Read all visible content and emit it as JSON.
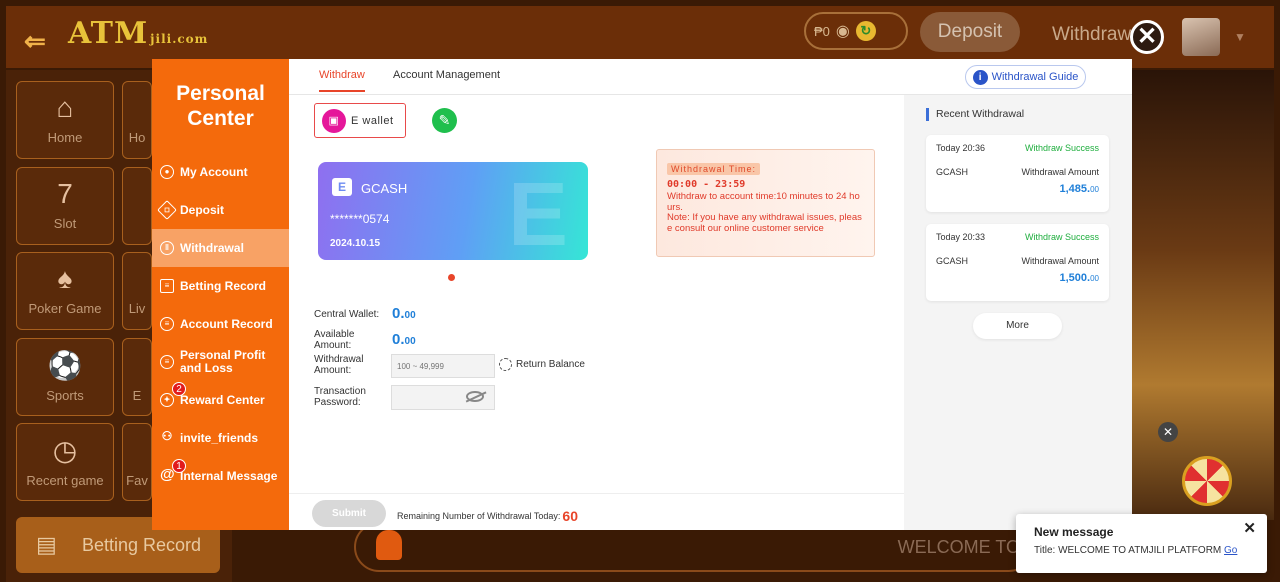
{
  "header": {
    "logo_text": "ATM",
    "logo_sub": "jili.com",
    "balance": "₱0",
    "deposit_label": "Deposit",
    "withdrawal_label": "Withdrawal"
  },
  "side_menu": {
    "tiles": [
      "Home",
      "Ho",
      "Slot",
      "Poker Game",
      "Liv",
      "Sports",
      "E",
      "Recent game",
      "Fav"
    ],
    "betting_record": "Betting Record"
  },
  "marquee_text": "WELCOME TO",
  "modal": {
    "title_line1": "Personal",
    "title_line2": "Center",
    "nav": [
      {
        "label": "My Account"
      },
      {
        "label": "Deposit"
      },
      {
        "label": "Withdrawal",
        "active": true
      },
      {
        "label": "Betting Record"
      },
      {
        "label": "Account Record"
      },
      {
        "label": "Personal Profit and Loss"
      },
      {
        "label": "Reward Center",
        "badge": "2"
      },
      {
        "label": "invite_friends"
      },
      {
        "label": "Internal Message",
        "badge": "1"
      }
    ],
    "tabs": [
      "Withdraw",
      "Account Management"
    ],
    "guide_label": "Withdrawal Guide",
    "ewallet_label": "E wallet",
    "card": {
      "name": "GCASH",
      "number": "*******0574",
      "date": "2024.10.15"
    },
    "withdrawal_time": {
      "title": "Withdrawal Time:",
      "hours": "00:00  - 23:59",
      "note1": "Withdraw to account time:10 minutes to 24 hours.",
      "note2": "Note: If you have any withdrawal issues, please consult our online customer service"
    },
    "form": {
      "central_wallet_label": "Central Wallet:",
      "central_wallet_int": "0.",
      "central_wallet_dec": "00",
      "available_label": "Available Amount:",
      "available_int": "0.",
      "available_dec": "00",
      "withdrawal_amount_label": "Withdrawal Amount:",
      "withdrawal_amount_placeholder": "100 ~ 49,999",
      "return_balance": "Return Balance",
      "password_label": "Transaction Password:"
    },
    "submit_label": "Submit",
    "remaining_label": "Remaining Number of Withdrawal Today:",
    "remaining_count": "60",
    "recent": {
      "title": "Recent Withdrawal",
      "items": [
        {
          "time": "Today 20:36",
          "status": "Withdraw Success",
          "method": "GCASH",
          "amount_label": "Withdrawal Amount",
          "amount_int": "1,485.",
          "amount_dec": "00"
        },
        {
          "time": "Today 20:33",
          "status": "Withdraw Success",
          "method": "GCASH",
          "amount_label": "Withdrawal Amount",
          "amount_int": "1,500.",
          "amount_dec": "00"
        }
      ],
      "more_label": "More"
    }
  },
  "toast": {
    "title": "New message",
    "body": "Title: WELCOME TO ATMJILI PLATFORM",
    "go_label": "Go"
  },
  "colors": {
    "accent": "#f46a0c",
    "active_tab": "#e8452a",
    "amount_blue": "#1f7fd8",
    "success_green": "#1fae3e"
  }
}
